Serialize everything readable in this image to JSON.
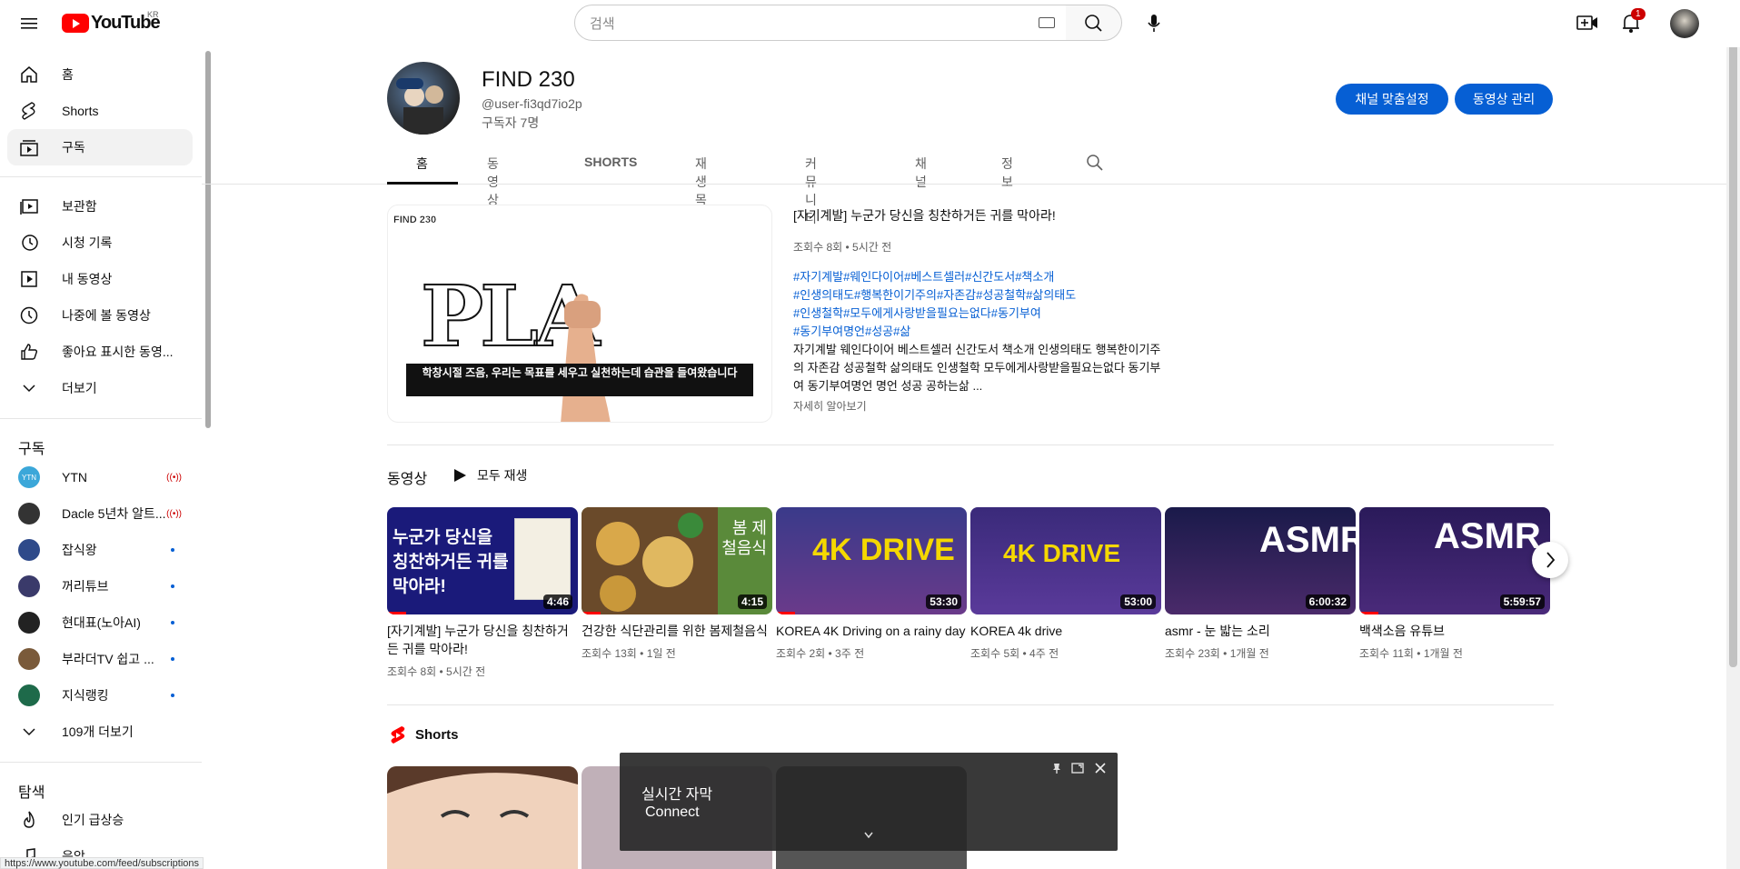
{
  "header": {
    "logo_text": "YouTube",
    "country_code": "KR",
    "search_placeholder": "검색",
    "notification_count": "1"
  },
  "sidebar": {
    "main": [
      {
        "label": "홈",
        "icon": "home-icon"
      },
      {
        "label": "Shorts",
        "icon": "shorts-icon"
      },
      {
        "label": "구독",
        "icon": "subscriptions-icon"
      }
    ],
    "library": [
      {
        "label": "보관함",
        "icon": "library-icon"
      },
      {
        "label": "시청 기록",
        "icon": "history-icon"
      },
      {
        "label": "내 동영상",
        "icon": "your-videos-icon"
      },
      {
        "label": "나중에 볼 동영상",
        "icon": "watch-later-icon"
      },
      {
        "label": "좋아요 표시한 동영...",
        "icon": "liked-icon"
      },
      {
        "label": "더보기",
        "icon": "chevron-down-icon"
      }
    ],
    "subscriptions_heading": "구독",
    "subscriptions": [
      {
        "label": "YTN",
        "status": "live",
        "avatar_text": "YTN",
        "color": "#3ba7d9"
      },
      {
        "label": "Dacle 5년차 알트...",
        "status": "live",
        "avatar_text": "",
        "color": "#333333"
      },
      {
        "label": "잡식왕",
        "status": "new",
        "avatar_text": "",
        "color": "#2e4a8a"
      },
      {
        "label": "꺼리튜브",
        "status": "new",
        "avatar_text": "",
        "color": "#3a3a6a"
      },
      {
        "label": "현대표(노아AI)",
        "status": "new",
        "avatar_text": "",
        "color": "#222222"
      },
      {
        "label": "부라더TV 쉽고 ...",
        "status": "new",
        "avatar_text": "",
        "color": "#7a5a3a"
      },
      {
        "label": "지식랭킹",
        "status": "new",
        "avatar_text": "",
        "color": "#1e6a4a"
      }
    ],
    "more_subs": "109개 더보기",
    "explore_heading": "탐색",
    "explore": [
      {
        "label": "인기 급상승",
        "icon": "trending-icon"
      },
      {
        "label": "음악",
        "icon": "music-icon"
      }
    ]
  },
  "channel": {
    "name": "FIND 230",
    "handle": "@user-fi3qd7io2p",
    "subscribers": "구독자 7명",
    "customize_button": "채널 맞춤설정",
    "manage_button": "동영상 관리",
    "tabs": [
      "홈",
      "동영상",
      "SHORTS",
      "재생목록",
      "커뮤니티",
      "채널",
      "정보"
    ]
  },
  "featured": {
    "thumb_label": "FIND 230",
    "thumb_word": "PLA",
    "thumb_caption": "학창시절 즈음, 우리는 목표를 세우고 실천하는데 습관을 들여왔습니다",
    "title": "[자기계발] 누군가 당신을 칭찬하거든 귀를 막아라!",
    "meta": "조회수 8회 • 5시간 전",
    "tags": [
      "#자기계발#웨인다이어#베스트셀러#신간도서#책소개",
      "#인생의태도#행복한이기주의#자존감#성공철학#삶의태도",
      "#인생철학#모두에게사랑받을필요는없다#동기부여",
      "#동기부여명언#성공#삶"
    ],
    "description": "자기계발 웨인다이어 베스트셀러 신간도서 책소개 인생의태도 행복한이기주의 자존감 성공철학 삶의태도 인생철학 모두에게사랑받을필요는없다 동기부여 동기부여명언 명언 성공 공하는삶 ...",
    "more": "자세히 알아보기"
  },
  "videos_section": {
    "title": "동영상",
    "play_all": "모두 재생",
    "videos": [
      {
        "title": "[자기계발] 누군가 당신을 칭찬하거든 귀를 막아라!",
        "meta": "조회수 8회 • 5시간 전",
        "duration": "4:46",
        "thumb_text": "누군가 당신을 칭찬하거든 귀를 막아라!",
        "bg": "#1a1a7a",
        "progress": 0.1
      },
      {
        "title": "건강한 식단관리를 위한 봄제철음식",
        "meta": "조회수 13회 • 1일 전",
        "duration": "4:15",
        "thumb_text": "봄 제철음식",
        "bg": "#5a8a3a",
        "progress": 0.1
      },
      {
        "title": "KOREA 4K Driving on a rainy day",
        "meta": "조회수 2회 • 3주 전",
        "duration": "53:30",
        "thumb_text": "4K DRIVE",
        "bg": "#3a3a8a",
        "progress": 0.1
      },
      {
        "title": "KOREA 4k drive",
        "meta": "조회수 5회 • 4주 전",
        "duration": "53:00",
        "thumb_text": "4K DRIVE",
        "bg": "#3a2a7a",
        "progress": 0
      },
      {
        "title": "asmr - 눈 밟는 소리",
        "meta": "조회수 23회 • 1개월 전",
        "duration": "6:00:32",
        "thumb_text": "ASMR",
        "bg": "#1a1a4a",
        "progress": 0
      },
      {
        "title": "백색소음 유튜브",
        "meta": "조회수 11회 • 1개월 전",
        "duration": "5:59:57",
        "thumb_text": "ASMR",
        "bg": "#2a1a5a",
        "progress": 0.1
      }
    ]
  },
  "shorts_section": {
    "title": "Shorts"
  },
  "caption_popup": {
    "title": "실시간 자막",
    "text": "Connect"
  },
  "status_url": "https://www.youtube.com/feed/subscriptions"
}
